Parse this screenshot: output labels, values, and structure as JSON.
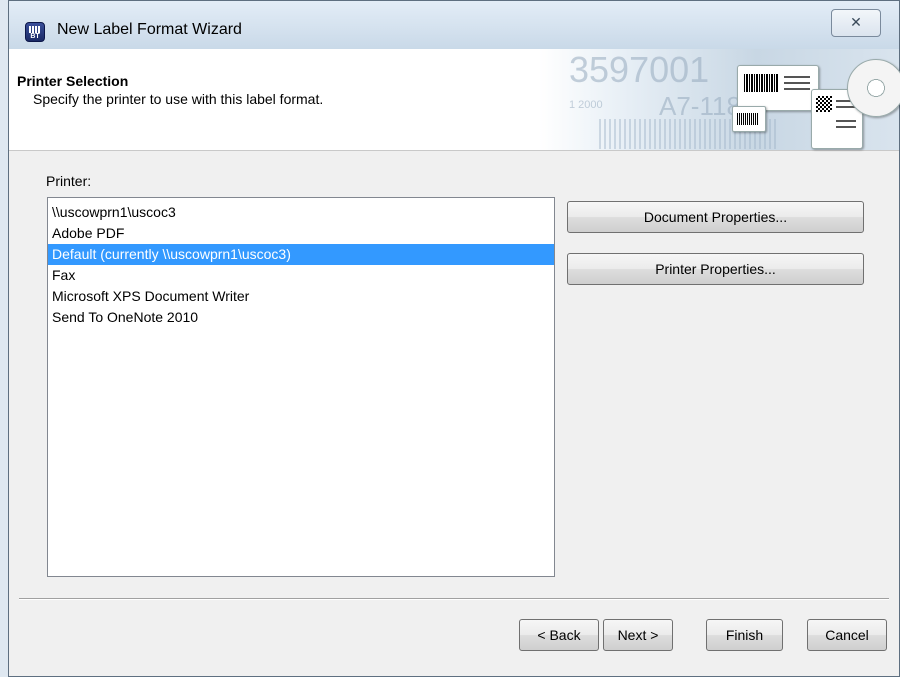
{
  "window": {
    "title": "New Label Format Wizard",
    "close_glyph": "✕"
  },
  "header": {
    "title": "Printer Selection",
    "subtitle": "Specify the printer to use with this label format."
  },
  "printer": {
    "label": "Printer:",
    "items": [
      "\\\\uscowprn1\\uscoc3",
      "Adobe PDF",
      "Default (currently \\\\uscowprn1\\uscoc3)",
      "Fax",
      "Microsoft XPS Document Writer",
      "Send To OneNote 2010"
    ],
    "selected": "Default (currently \\\\uscowprn1\\uscoc3)"
  },
  "buttons": {
    "document_properties": "Document Properties...",
    "printer_properties": "Printer Properties...",
    "back": "< Back",
    "next": "Next >",
    "finish": "Finish",
    "cancel": "Cancel"
  },
  "colors": {
    "selection": "#3399ff"
  }
}
